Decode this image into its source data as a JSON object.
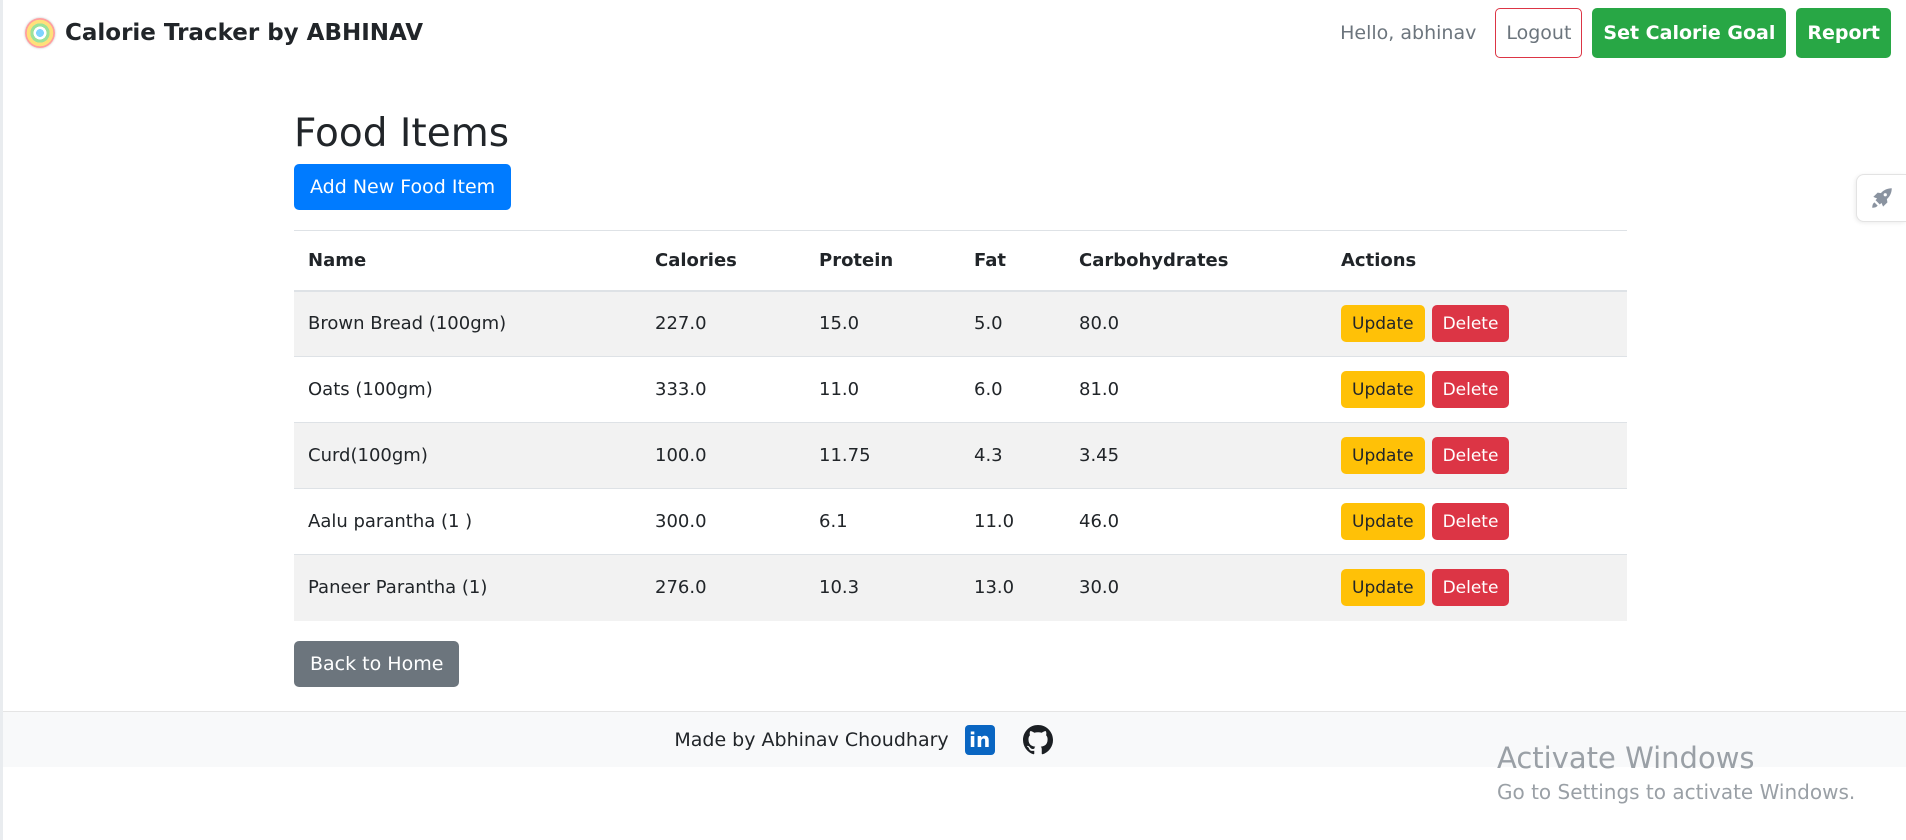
{
  "navbar": {
    "brand_title": "Calorie Tracker by ABHINAV",
    "greeting": "Hello, abhinav",
    "logout_label": "Logout",
    "set_goal_label": "Set Calorie Goal",
    "report_label": "Report"
  },
  "main": {
    "title": "Food Items",
    "add_button_label": "Add New Food Item",
    "back_button_label": "Back to Home",
    "table": {
      "headers": [
        "Name",
        "Calories",
        "Protein",
        "Fat",
        "Carbohydrates",
        "Actions"
      ],
      "update_label": "Update",
      "delete_label": "Delete",
      "rows": [
        {
          "name": "Brown Bread (100gm)",
          "calories": "227.0",
          "protein": "15.0",
          "fat": "5.0",
          "carbs": "80.0"
        },
        {
          "name": "Oats (100gm)",
          "calories": "333.0",
          "protein": "11.0",
          "fat": "6.0",
          "carbs": "81.0"
        },
        {
          "name": "Curd(100gm)",
          "calories": "100.0",
          "protein": "11.75",
          "fat": "4.3",
          "carbs": "3.45"
        },
        {
          "name": "Aalu parantha (1 )",
          "calories": "300.0",
          "protein": "6.1",
          "fat": "11.0",
          "carbs": "46.0"
        },
        {
          "name": "Paneer Parantha (1)",
          "calories": "276.0",
          "protein": "10.3",
          "fat": "13.0",
          "carbs": "30.0"
        }
      ]
    }
  },
  "footer": {
    "text": "Made by Abhinav Choudhary",
    "linkedin_icon": "linkedin-icon",
    "github_icon": "github-icon"
  },
  "side_widget": {
    "icon": "rocket-icon"
  },
  "watermark": {
    "title": "Activate Windows",
    "subtitle": "Go to Settings to activate Windows."
  },
  "colors": {
    "primary": "#007bff",
    "success": "#28a745",
    "warning": "#ffc107",
    "danger": "#dc3545",
    "secondary": "#6c757d"
  }
}
